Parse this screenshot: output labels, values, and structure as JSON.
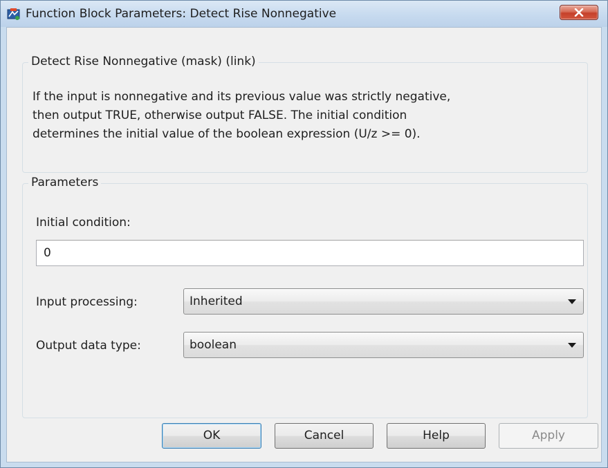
{
  "window": {
    "title": "Function Block Parameters: Detect Rise Nonnegative"
  },
  "description": {
    "group_title": "Detect Rise Nonnegative (mask) (link)",
    "lines": [
      "If the input is nonnegative and its previous value was strictly negative,",
      "then output TRUE, otherwise output FALSE.  The initial condition",
      "determines the initial value of the boolean expression (U/z >= 0)."
    ]
  },
  "parameters": {
    "group_title": "Parameters",
    "initial_condition": {
      "label": "Initial condition:",
      "value": "0"
    },
    "input_processing": {
      "label": "Input processing:",
      "value": "Inherited"
    },
    "output_data_type": {
      "label": "Output data type:",
      "value": "boolean"
    }
  },
  "buttons": {
    "ok": "OK",
    "cancel": "Cancel",
    "help": "Help",
    "apply": "Apply"
  },
  "icons": {
    "app": "simulink-block-icon",
    "close": "close-icon",
    "dropdown": "chevron-down-icon"
  },
  "colors": {
    "titlebar": "#c7daef",
    "close_button": "#c5402a",
    "client_background": "#f0f0f0",
    "default_button_border": "#3c7fb1"
  }
}
